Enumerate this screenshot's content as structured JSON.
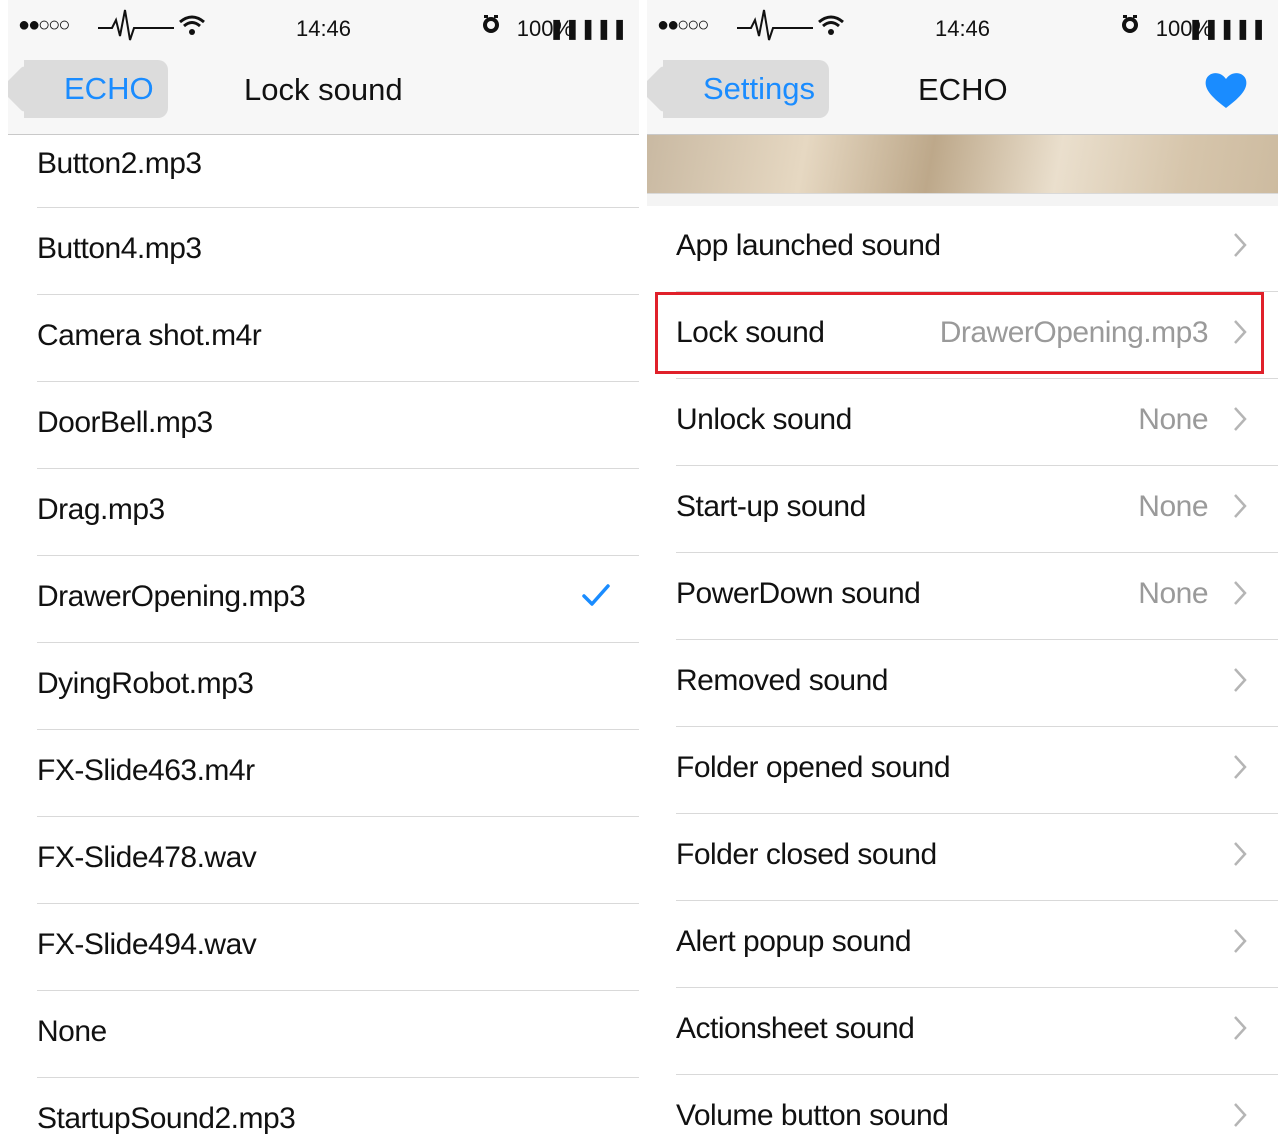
{
  "status_bar": {
    "signal": "●●○○○",
    "time": "14:46",
    "battery": "100%",
    "battery_glyph": "❚❚❚❚❚"
  },
  "left_panel": {
    "back_label": "ECHO",
    "title": "Lock sound",
    "items": [
      "Button2.mp3",
      "Button4.mp3",
      "Camera shot.m4r",
      "DoorBell.mp3",
      "Drag.mp3",
      "DrawerOpening.mp3",
      "DyingRobot.mp3",
      "FX-Slide463.m4r",
      "FX-Slide478.wav",
      "FX-Slide494.wav",
      "None",
      "StartupSound2.mp3"
    ],
    "selected_item": "DrawerOpening.mp3"
  },
  "right_panel": {
    "back_label": "Settings",
    "title": "ECHO",
    "rows": [
      {
        "label": "App launched sound",
        "value": ""
      },
      {
        "label": "Lock sound",
        "value": "DrawerOpening.mp3"
      },
      {
        "label": "Unlock sound",
        "value": "None"
      },
      {
        "label": "Start-up sound",
        "value": "None"
      },
      {
        "label": "PowerDown sound",
        "value": "None"
      },
      {
        "label": "Removed sound",
        "value": ""
      },
      {
        "label": "Folder opened sound",
        "value": ""
      },
      {
        "label": "Folder closed sound",
        "value": ""
      },
      {
        "label": "Alert popup sound",
        "value": ""
      },
      {
        "label": "Actionsheet sound",
        "value": ""
      },
      {
        "label": "Volume button sound",
        "value": ""
      }
    ]
  },
  "colors": {
    "accent": "#1a8cff",
    "highlight_border": "#e0202a",
    "secondary_text": "#9a9a9a"
  },
  "icons": {
    "back": "back-arrow-icon",
    "check": "checkmark-icon",
    "chevron": "chevron-right-icon",
    "favorite": "heart-icon",
    "wifi": "wifi-icon",
    "alarm": "alarm-icon",
    "activity": "pulse-icon"
  }
}
